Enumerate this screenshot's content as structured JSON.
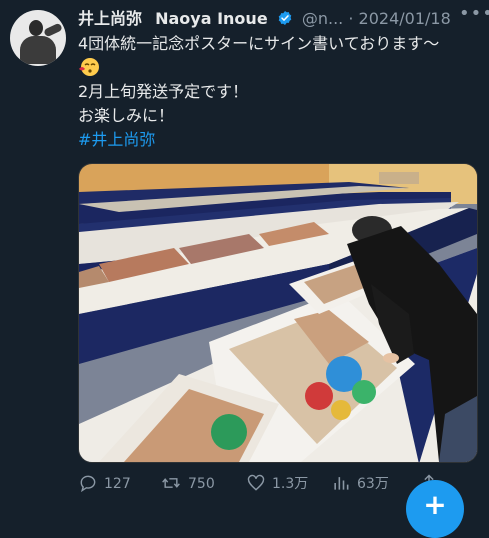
{
  "tweet": {
    "display_name": "井上尚弥",
    "name_en": "Naoya Inoue",
    "handle": "@n...",
    "separator": "·",
    "date": "2024/01/18",
    "text_line1": "4団体統一記念ポスターにサイン書いております～",
    "emoji": "kissing-face-emoji",
    "text_line2": "2月上旬発送予定です！",
    "text_line3": "お楽しみに！",
    "hashtag": "#井上尚弥"
  },
  "stats": {
    "replies": "127",
    "retweets": "750",
    "likes": "1.3万",
    "views": "63万"
  },
  "fab": {
    "label": "+"
  },
  "colors": {
    "background": "#15202b",
    "text": "#e7e9ea",
    "muted": "#8b98a5",
    "accent": "#1d9bf0",
    "verified": "#1d9bf0"
  }
}
